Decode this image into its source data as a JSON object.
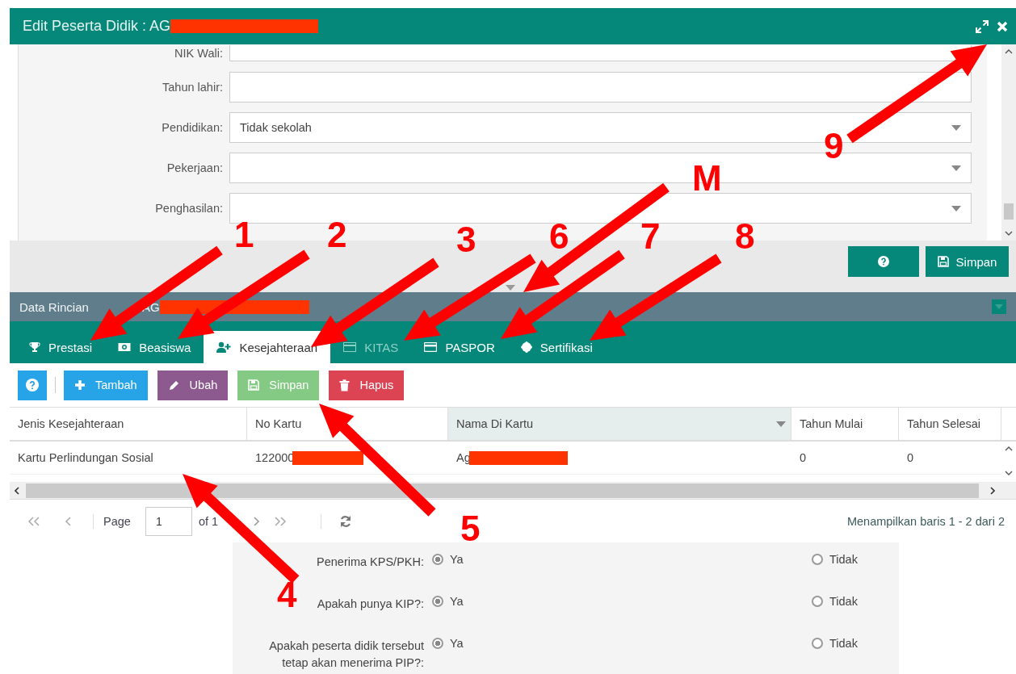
{
  "dialog": {
    "title": "Edit Peserta Didik : AG",
    "redacted": true
  },
  "form": {
    "fields": [
      {
        "label": "NIK Wali:",
        "kind": "text"
      },
      {
        "label": "Tahun lahir:",
        "kind": "text"
      },
      {
        "label": "Pendidikan:",
        "kind": "select",
        "value": "Tidak sekolah"
      },
      {
        "label": "Pekerjaan:",
        "kind": "select"
      },
      {
        "label": "Penghasilan:",
        "kind": "select"
      }
    ]
  },
  "footer_buttons": [
    {
      "kind": "help"
    },
    {
      "kind": "save",
      "label": "Simpan"
    }
  ],
  "detail": {
    "title": "Data Rincian",
    "title_tail": "AG",
    "redacted": true,
    "tabs": [
      {
        "label": "Prestasi",
        "selected": false,
        "disabled": false
      },
      {
        "label": "Beasiswa",
        "selected": false,
        "disabled": false
      },
      {
        "label": "Kesejahteraan",
        "selected": true,
        "disabled": false
      },
      {
        "label": "KITAS",
        "selected": false,
        "disabled": true
      },
      {
        "label": "PASPOR",
        "selected": false,
        "disabled": false
      },
      {
        "label": "Sertifikasi",
        "selected": false,
        "disabled": false
      }
    ],
    "toolbar": [
      {
        "kind": "help",
        "disabled": false
      },
      {
        "kind": "add",
        "label": "Tambah",
        "disabled": false
      },
      {
        "kind": "edit",
        "label": "Ubah",
        "disabled": false
      },
      {
        "kind": "save",
        "label": "Simpan",
        "disabled": true
      },
      {
        "kind": "delete",
        "label": "Hapus",
        "disabled": false
      }
    ],
    "table": {
      "columns": [
        {
          "label": "Jenis Kesejahteraan",
          "active": false
        },
        {
          "label": "No Kartu",
          "active": false
        },
        {
          "label": "Nama Di Kartu",
          "active": true
        },
        {
          "label": "Tahun Mulai",
          "active": false
        },
        {
          "label": "Tahun Selesai",
          "active": false
        }
      ],
      "rows": [
        {
          "cells": [
            {
              "text": "Kartu Perlindungan Sosial",
              "redacted": false
            },
            {
              "text": "122000",
              "redacted": true
            },
            {
              "text": "Ag",
              "redacted": true
            },
            {
              "text": "0",
              "redacted": false
            },
            {
              "text": "0",
              "redacted": false
            }
          ]
        }
      ]
    },
    "pager": {
      "page_label": "Page",
      "page": "1",
      "of": "of 1",
      "summary": "Menampilkan baris 1 - 2 dari 2"
    }
  },
  "radio_groups": [
    {
      "label": "Penerima KPS/PKH:",
      "options": [
        {
          "label": "Ya",
          "selected": true
        },
        {
          "label": "Tidak",
          "selected": false
        }
      ]
    },
    {
      "label": "Apakah punya KIP?:",
      "options": [
        {
          "label": "Ya",
          "selected": true
        },
        {
          "label": "Tidak",
          "selected": false
        }
      ]
    },
    {
      "label": "Apakah peserta didik tersebut tetap akan menerima PIP?:",
      "options": [
        {
          "label": "Ya",
          "selected": true
        },
        {
          "label": "Tidak",
          "selected": false
        }
      ]
    }
  ],
  "annotations": [
    {
      "label": "1"
    },
    {
      "label": "2"
    },
    {
      "label": "3"
    },
    {
      "label": "6"
    },
    {
      "label": "7"
    },
    {
      "label": "8"
    },
    {
      "label": "M"
    },
    {
      "label": "9"
    },
    {
      "label": "4"
    },
    {
      "label": "5"
    }
  ]
}
